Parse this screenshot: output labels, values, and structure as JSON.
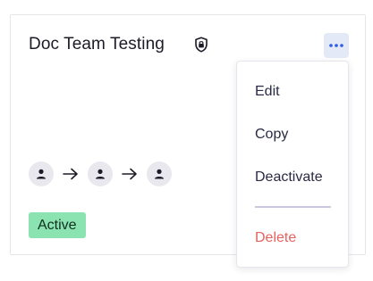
{
  "card": {
    "title": "Doc Team Testing",
    "status_label": "Active",
    "status_color": "#8be3b1",
    "flow_steps": [
      "user-icon",
      "arrow-right-icon",
      "user-icon",
      "arrow-right-icon",
      "user-icon"
    ]
  },
  "menu": {
    "items": [
      {
        "label": "Edit"
      },
      {
        "label": "Copy"
      },
      {
        "label": "Deactivate"
      },
      {
        "label": "Delete",
        "color": "#e5625e"
      }
    ]
  },
  "colors": {
    "accent": "#2d5be3",
    "more_button_bg": "#e4e9f8",
    "danger": "#e5625e"
  }
}
